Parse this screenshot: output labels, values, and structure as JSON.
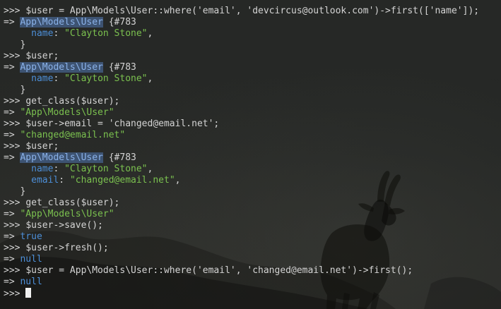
{
  "terminal": {
    "lines": [
      [
        {
          "t": ">>> ",
          "c": "prompt"
        },
        {
          "t": "$user = App\\Models\\User::where('email', 'devcircus@outlook.com')->first(['name']);",
          "c": "plain"
        }
      ],
      [
        {
          "t": "=> ",
          "c": "arrow"
        },
        {
          "t": "App\\Models\\User",
          "c": "classname hl"
        },
        {
          "t": " {#783",
          "c": "plain"
        }
      ],
      [
        {
          "t": "     ",
          "c": "plain"
        },
        {
          "t": "name",
          "c": "key"
        },
        {
          "t": ": ",
          "c": "plain"
        },
        {
          "t": "\"Clayton Stone\"",
          "c": "string"
        },
        {
          "t": ",",
          "c": "plain"
        }
      ],
      [
        {
          "t": "   }",
          "c": "plain"
        }
      ],
      [
        {
          "t": ">>> ",
          "c": "prompt"
        },
        {
          "t": "$user;",
          "c": "plain"
        }
      ],
      [
        {
          "t": "=> ",
          "c": "arrow"
        },
        {
          "t": "App\\Models\\User",
          "c": "classname hl"
        },
        {
          "t": " {#783",
          "c": "plain"
        }
      ],
      [
        {
          "t": "     ",
          "c": "plain"
        },
        {
          "t": "name",
          "c": "key"
        },
        {
          "t": ": ",
          "c": "plain"
        },
        {
          "t": "\"Clayton Stone\"",
          "c": "string"
        },
        {
          "t": ",",
          "c": "plain"
        }
      ],
      [
        {
          "t": "   }",
          "c": "plain"
        }
      ],
      [
        {
          "t": ">>> ",
          "c": "prompt"
        },
        {
          "t": "get_class($user);",
          "c": "plain"
        }
      ],
      [
        {
          "t": "=> ",
          "c": "arrow"
        },
        {
          "t": "\"App\\Models\\User\"",
          "c": "string"
        }
      ],
      [
        {
          "t": ">>> ",
          "c": "prompt"
        },
        {
          "t": "$user->email = 'changed@email.net';",
          "c": "plain"
        }
      ],
      [
        {
          "t": "=> ",
          "c": "arrow"
        },
        {
          "t": "\"changed@email.net\"",
          "c": "string"
        }
      ],
      [
        {
          "t": ">>> ",
          "c": "prompt"
        },
        {
          "t": "$user;",
          "c": "plain"
        }
      ],
      [
        {
          "t": "=> ",
          "c": "arrow"
        },
        {
          "t": "App\\Models\\User",
          "c": "classname hl"
        },
        {
          "t": " {#783",
          "c": "plain"
        }
      ],
      [
        {
          "t": "     ",
          "c": "plain"
        },
        {
          "t": "name",
          "c": "key"
        },
        {
          "t": ": ",
          "c": "plain"
        },
        {
          "t": "\"Clayton Stone\"",
          "c": "string"
        },
        {
          "t": ",",
          "c": "plain"
        }
      ],
      [
        {
          "t": "     ",
          "c": "plain"
        },
        {
          "t": "email",
          "c": "key"
        },
        {
          "t": ": ",
          "c": "plain"
        },
        {
          "t": "\"changed@email.net\"",
          "c": "string"
        },
        {
          "t": ",",
          "c": "plain"
        }
      ],
      [
        {
          "t": "   }",
          "c": "plain"
        }
      ],
      [
        {
          "t": ">>> ",
          "c": "prompt"
        },
        {
          "t": "get_class($user);",
          "c": "plain"
        }
      ],
      [
        {
          "t": "=> ",
          "c": "arrow"
        },
        {
          "t": "\"App\\Models\\User\"",
          "c": "string"
        }
      ],
      [
        {
          "t": ">>> ",
          "c": "prompt"
        },
        {
          "t": "$user->save();",
          "c": "plain"
        }
      ],
      [
        {
          "t": "=> ",
          "c": "arrow"
        },
        {
          "t": "true",
          "c": "bool-null"
        }
      ],
      [
        {
          "t": ">>> ",
          "c": "prompt"
        },
        {
          "t": "$user->fresh();",
          "c": "plain"
        }
      ],
      [
        {
          "t": "=> ",
          "c": "arrow"
        },
        {
          "t": "null",
          "c": "bool-null"
        }
      ],
      [
        {
          "t": ">>> ",
          "c": "prompt"
        },
        {
          "t": "$user = App\\Models\\User::where('email', 'changed@email.net')->first();",
          "c": "plain"
        }
      ],
      [
        {
          "t": "=> ",
          "c": "arrow"
        },
        {
          "t": "null",
          "c": "bool-null"
        }
      ],
      [
        {
          "t": ">>> ",
          "c": "prompt"
        }
      ]
    ]
  },
  "colors": {
    "background": "#242624",
    "text": "#d4d4d4",
    "string": "#7bc14f",
    "key": "#4d8fd8",
    "class_highlight_bg": "#3d5372",
    "cursor": "#f0f0f0"
  },
  "icons": {
    "background_image": "ibex-silhouette",
    "cursor": "block-cursor"
  }
}
